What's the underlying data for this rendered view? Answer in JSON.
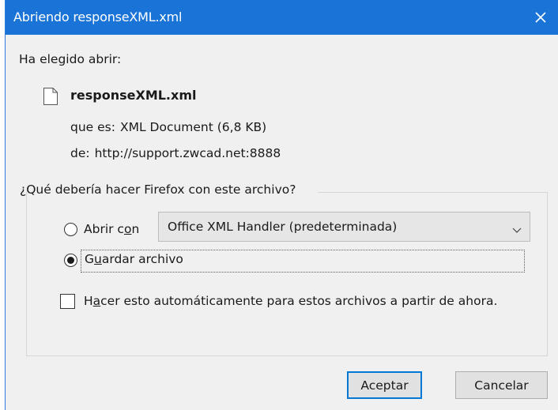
{
  "window": {
    "title": "Abriendo responseXML.xml",
    "close_icon": "close-icon",
    "accent_color": "#1a73d6"
  },
  "intro": "Ha elegido abrir:",
  "file": {
    "icon": "file-icon",
    "name": "responseXML.xml",
    "type_label": "que es:",
    "type_value": "XML Document (6,8 KB)",
    "from_label": "de:",
    "from_value": "http://support.zwcad.net:8888"
  },
  "question": "¿Qué debería hacer Firefox con este archivo?",
  "options": {
    "open_with": {
      "label_pre": "Abrir c",
      "label_access": "o",
      "label_post": "n",
      "checked": false
    },
    "handler": {
      "value": "Office XML Handler (predeterminada)"
    },
    "save": {
      "label_pre": "G",
      "label_access": "u",
      "label_post": "ardar archivo",
      "checked": true
    },
    "auto": {
      "label_pre": "H",
      "label_access": "a",
      "label_post": "cer esto automáticamente para estos archivos a partir de ahora.",
      "checked": false
    }
  },
  "buttons": {
    "accept": "Aceptar",
    "cancel": "Cancelar"
  }
}
